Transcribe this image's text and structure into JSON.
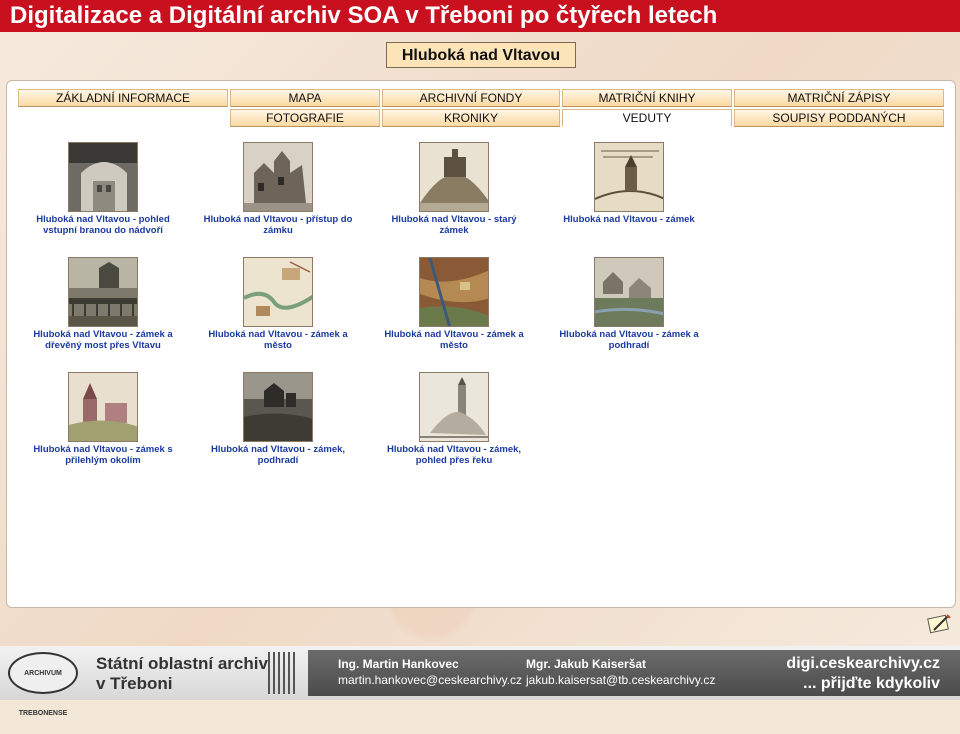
{
  "slide": {
    "title": "Digitalizace a Digitální archiv SOA v Třeboni po čtyřech letech"
  },
  "page": {
    "place_title": "Hluboká nad Vltavou"
  },
  "tabs": {
    "row1": [
      "ZÁKLADNÍ INFORMACE",
      "MAPA",
      "ARCHIVNÍ FONDY",
      "MATRIČNÍ KNIHY",
      "MATRIČNÍ ZÁPISY"
    ],
    "row2": [
      "FOTOGRAFIE",
      "KRONIKY",
      "VEDUTY",
      "SOUPISY PODDANÝCH"
    ],
    "active": "VEDUTY"
  },
  "gallery": [
    {
      "line1": "Hluboká nad Vltavou - pohled",
      "line2": "vstupní branou do nádvoří",
      "icon": "gate-photo"
    },
    {
      "line1": "Hluboká nad Vltavou - přístup do",
      "line2": "zámku",
      "icon": "castle-sketch"
    },
    {
      "line1": "Hluboká nad Vltavou - starý zámek",
      "line2": "",
      "icon": "castle-hill"
    },
    {
      "line1": "Hluboká nad Vltavou - zámek",
      "line2": "",
      "icon": "castle-drawing"
    },
    {
      "line1": "Hluboká nad Vltavou - zámek a",
      "line2": "dřevěný most přes Vltavu",
      "icon": "bridge-painting"
    },
    {
      "line1": "Hluboká nad Vltavou - zámek a",
      "line2": "město",
      "icon": "town-map"
    },
    {
      "line1": "Hluboká nad Vltavou - zámek a",
      "line2": "město",
      "icon": "colored-map"
    },
    {
      "line1": "Hluboká nad Vltavou - zámek a",
      "line2": "podhradí",
      "icon": "village-painting"
    },
    {
      "line1": "Hluboká nad Vltavou - zámek s",
      "line2": "přilehlým okolím",
      "icon": "watercolor-castle"
    },
    {
      "line1": "Hluboká nad Vltavou - zámek,",
      "line2": "podhradí",
      "icon": "engraving-castle"
    },
    {
      "line1": "Hluboká nad Vltavou - zámek,",
      "line2": "pohled přes řeku",
      "icon": "sketch-tower"
    }
  ],
  "footer": {
    "seal_text": "ARCHIVUM TREBONENSE",
    "org_line1": "Státní oblastní archiv",
    "org_line2": "v Třeboni",
    "contact1_name": "Ing. Martin Hankovec",
    "contact1_email": "martin.hankovec@ceskearchivy.cz",
    "contact2_name": "Mgr. Jakub Kaiseršat",
    "contact2_email": "jakub.kaisersat@tb.ceskearchivy.cz",
    "site": "digi.ceskearchivy.cz",
    "tagline": "... přijďte kdykoliv"
  },
  "colors": {
    "title_bar": "#c8101e",
    "caption": "#1a3aa0",
    "tab_gradient_bottom": "#fbd9a3"
  }
}
